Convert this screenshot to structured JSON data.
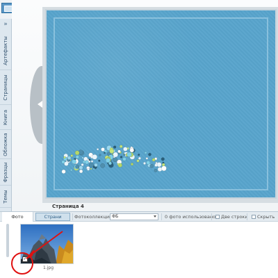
{
  "sidebar": {
    "collapse_icon": "double-chevron-right-icon",
    "tabs": [
      {
        "label": "Артефакты"
      },
      {
        "label": "Страницы"
      },
      {
        "label": "Книга"
      },
      {
        "label": "Обложка"
      },
      {
        "label": "Фразцы"
      },
      {
        "label": "Темы"
      }
    ]
  },
  "canvas": {
    "page_label": "Страница 4",
    "background_color": "#58a4cc"
  },
  "toolbar": {
    "tab_photo": "Фото",
    "tab_pages": "Страни",
    "collections_label": "Фотоколлекции",
    "collection_select": "ФБ",
    "used_count_text": "0 фото использовано",
    "two_rows_label": "Две строки",
    "hide_label": "Скрыть"
  },
  "photos": [
    {
      "filename": "1.jpg",
      "checked": true
    }
  ],
  "colors": {
    "accent": "#58a4cc",
    "annotation": "#e01010"
  }
}
